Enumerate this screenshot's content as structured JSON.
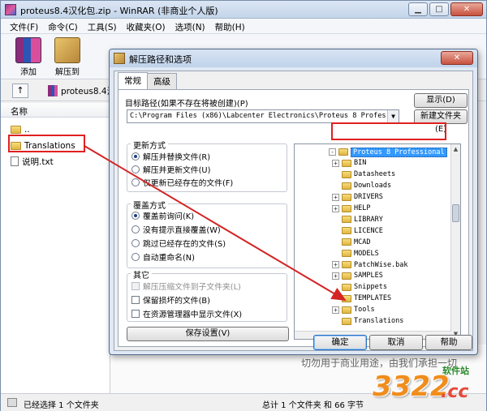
{
  "main_window": {
    "title": "proteus8.4汉化包.zip - WinRAR (非商业个人版)",
    "controls": {
      "minimize": "▁",
      "maximize": "□",
      "close": "✕"
    }
  },
  "menubar": [
    "文件(F)",
    "命令(C)",
    "工具(S)",
    "收藏夹(O)",
    "选项(N)",
    "帮助(H)"
  ],
  "toolbar": {
    "add_label": "添加",
    "extract_label": "解压到"
  },
  "addressbar": {
    "path": "proteus8.4汉"
  },
  "file_list": {
    "column_name": "名称",
    "rows": [
      {
        "name": "..",
        "type": "folder"
      },
      {
        "name": "Translations",
        "type": "folder"
      },
      {
        "name": "说明.txt",
        "type": "text"
      }
    ]
  },
  "background_text": "切勿用于商业用途，由我们承担一切",
  "status": {
    "left": "已经选择 1 个文件夹",
    "right": "总计 1 个文件夹 和 66 字节"
  },
  "dialog": {
    "title": "解压路径和选项",
    "close": "✕",
    "tabs": [
      "常规",
      "高级"
    ],
    "dest_label": "目标路径(如果不存在将被创建)(P)",
    "dest_path": "C:\\Program Files (x86)\\Labcenter Electronics\\Proteus 8 Profes",
    "btn_show": "显示(D)",
    "btn_newfolder": "新建文件夹(E)",
    "update_group": {
      "title": "更新方式",
      "options": [
        "解压并替换文件(R)",
        "解压并更新文件(U)",
        "仅更新已经存在的文件(F)"
      ],
      "selected": 0
    },
    "overwrite_group": {
      "title": "覆盖方式",
      "options": [
        "覆盖前询问(K)",
        "没有提示直接覆盖(W)",
        "跳过已经存在的文件(S)",
        "自动重命名(N)"
      ],
      "selected": 0
    },
    "other_group": {
      "title": "其它",
      "options": [
        "解压压缩文件到子文件夹(L)",
        "保留损坏的文件(B)",
        "在资源管理器中显示文件(X)"
      ]
    },
    "btn_save": "保存设置(V)",
    "tree": [
      {
        "label": "Proteus 8 Professional",
        "level": 0,
        "exp": "-",
        "selected": true
      },
      {
        "label": "BIN",
        "level": 1,
        "exp": "+"
      },
      {
        "label": "Datasheets",
        "level": 1,
        "exp": ""
      },
      {
        "label": "Downloads",
        "level": 1,
        "exp": ""
      },
      {
        "label": "DRIVERS",
        "level": 1,
        "exp": "+"
      },
      {
        "label": "HELP",
        "level": 1,
        "exp": "+"
      },
      {
        "label": "LIBRARY",
        "level": 1,
        "exp": ""
      },
      {
        "label": "LICENCE",
        "level": 1,
        "exp": ""
      },
      {
        "label": "MCAD",
        "level": 1,
        "exp": ""
      },
      {
        "label": "MODELS",
        "level": 1,
        "exp": ""
      },
      {
        "label": "PatchWise.bak",
        "level": 1,
        "exp": "+"
      },
      {
        "label": "SAMPLES",
        "level": 1,
        "exp": "+"
      },
      {
        "label": "Snippets",
        "level": 1,
        "exp": ""
      },
      {
        "label": "TEMPLATES",
        "level": 1,
        "exp": ""
      },
      {
        "label": "Tools",
        "level": 1,
        "exp": "+"
      },
      {
        "label": "Translations",
        "level": 1,
        "exp": ""
      }
    ],
    "btn_ok": "确定",
    "btn_cancel": "取消",
    "btn_help": "帮助"
  },
  "watermark": {
    "number": "3322",
    "site": "软件站",
    "tld": ".cc"
  },
  "colors": {
    "highlight": "#e02020",
    "selection": "#3399ff",
    "arrow": "#d42424"
  }
}
